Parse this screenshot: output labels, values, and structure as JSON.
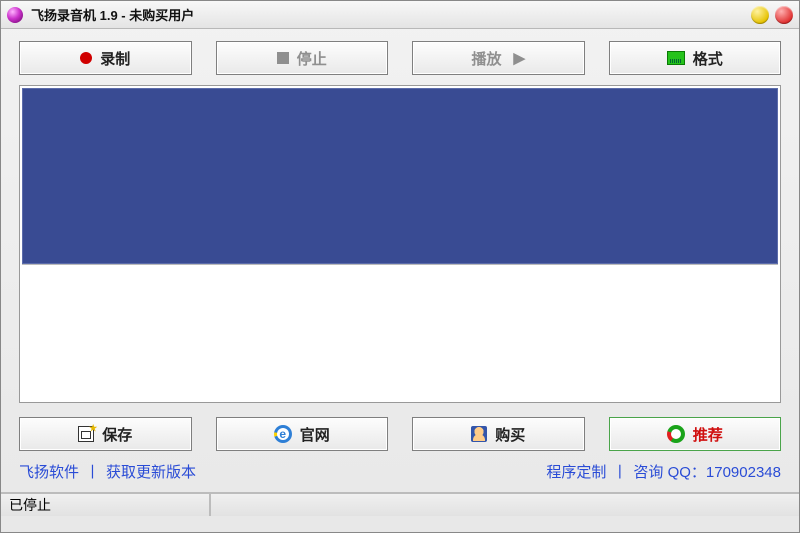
{
  "title": "飞扬录音机 1.9 - 未购买用户",
  "toolbar": {
    "record": "录制",
    "stop": "停止",
    "play": "播放",
    "format": "格式"
  },
  "toolbar2": {
    "save": "保存",
    "website": "官网",
    "buy": "购买",
    "recommend": "推荐"
  },
  "links": {
    "soft": "飞扬软件",
    "update": "获取更新版本",
    "custom": "程序定制",
    "consult": "咨询 QQ：170902348"
  },
  "separator": "丨",
  "status": "已停止"
}
